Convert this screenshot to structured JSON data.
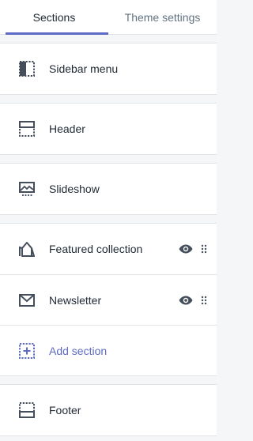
{
  "tabs": [
    {
      "label": "Sections",
      "active": true
    },
    {
      "label": "Theme settings",
      "active": false
    }
  ],
  "groups": [
    {
      "items": [
        {
          "label": "Sidebar menu",
          "icon": "sidebar-icon",
          "visibility_toggle": false,
          "draggable": false
        }
      ]
    },
    {
      "items": [
        {
          "label": "Header",
          "icon": "header-icon",
          "visibility_toggle": false,
          "draggable": false
        }
      ]
    },
    {
      "items": [
        {
          "label": "Slideshow",
          "icon": "slideshow-icon",
          "visibility_toggle": false,
          "draggable": false
        }
      ]
    },
    {
      "items": [
        {
          "label": "Featured collection",
          "icon": "featured-collection-icon",
          "visibility_toggle": true,
          "draggable": true
        },
        {
          "label": "Newsletter",
          "icon": "newsletter-icon",
          "visibility_toggle": true,
          "draggable": true
        },
        {
          "label": "Add section",
          "icon": "add-section-icon",
          "visibility_toggle": false,
          "draggable": false
        }
      ]
    },
    {
      "items": [
        {
          "label": "Footer",
          "icon": "footer-icon",
          "visibility_toggle": false,
          "draggable": false
        }
      ]
    }
  ],
  "colors": {
    "accent": "#5c6ac4",
    "text": "#212b36",
    "muted": "#637381",
    "background": "#f4f6f8",
    "border": "#dfe3e8",
    "icon": "#454f5b"
  }
}
